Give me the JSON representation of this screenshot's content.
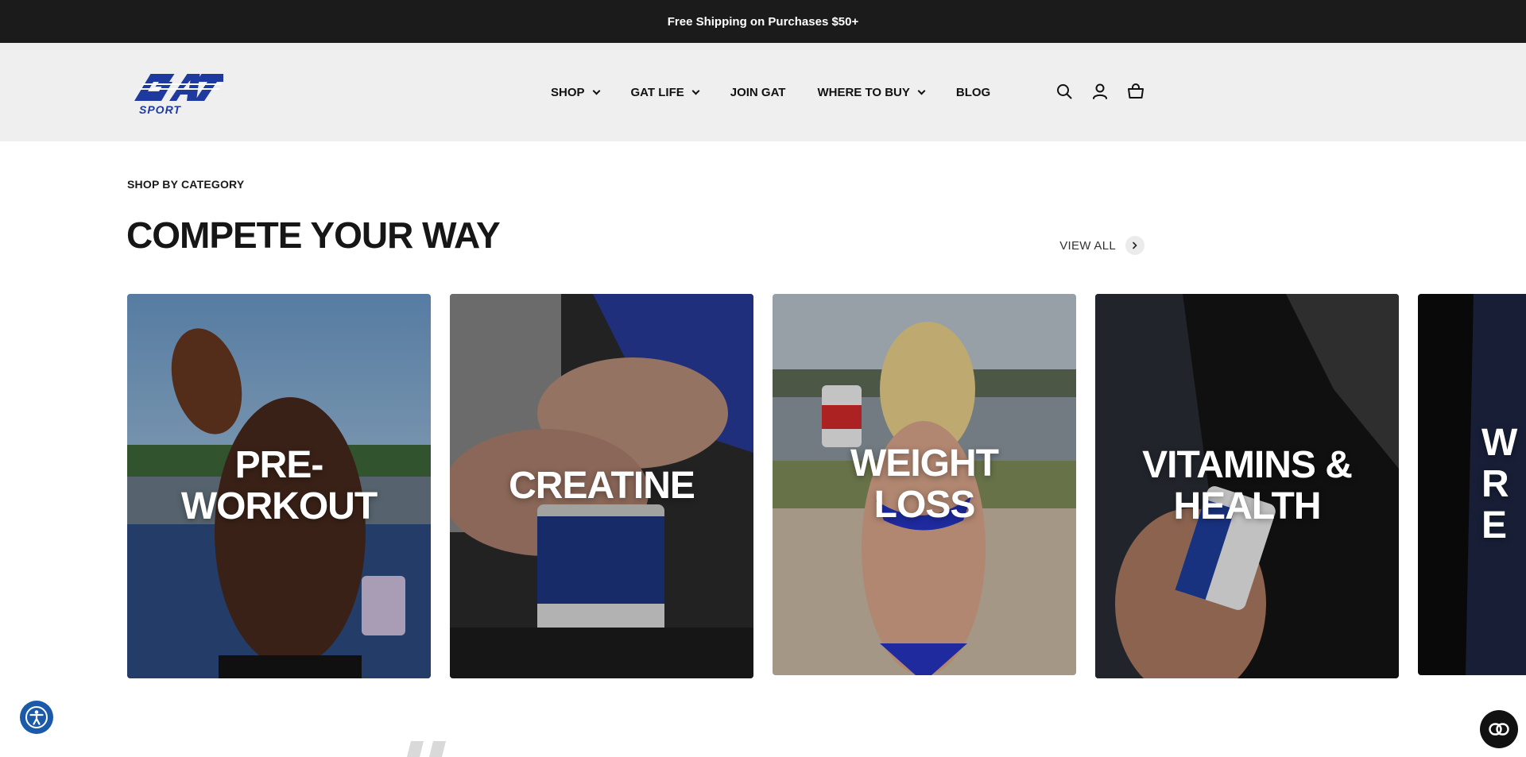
{
  "announcement": {
    "text": "Free Shipping on Purchases $50+"
  },
  "header": {
    "logo": {
      "name": "gat-sport-logo",
      "wordmark": "GAT",
      "subtext": "SPORT",
      "color": "#1e3a9e"
    },
    "nav": [
      {
        "label": "SHOP",
        "has_dropdown": true
      },
      {
        "label": "GAT LIFE",
        "has_dropdown": true
      },
      {
        "label": "JOIN GAT",
        "has_dropdown": false
      },
      {
        "label": "WHERE TO BUY",
        "has_dropdown": true
      },
      {
        "label": "BLOG",
        "has_dropdown": false
      }
    ],
    "icons": [
      "search-icon",
      "account-icon",
      "cart-icon"
    ]
  },
  "section": {
    "eyebrow": "SHOP BY CATEGORY",
    "title": "COMPETE YOUR WAY",
    "view_all": "VIEW ALL"
  },
  "categories": [
    {
      "label": "PRE-WORKOUT"
    },
    {
      "label": "CREATINE"
    },
    {
      "label": "WEIGHT LOSS"
    },
    {
      "label": "VITAMINS & HEALTH"
    },
    {
      "label": "W RE"
    }
  ],
  "colors": {
    "announcement_bg": "#1b1b1b",
    "header_bg": "#efefef",
    "accessibility": "#1a5aa8",
    "brand_blue": "#1e3a9e"
  }
}
